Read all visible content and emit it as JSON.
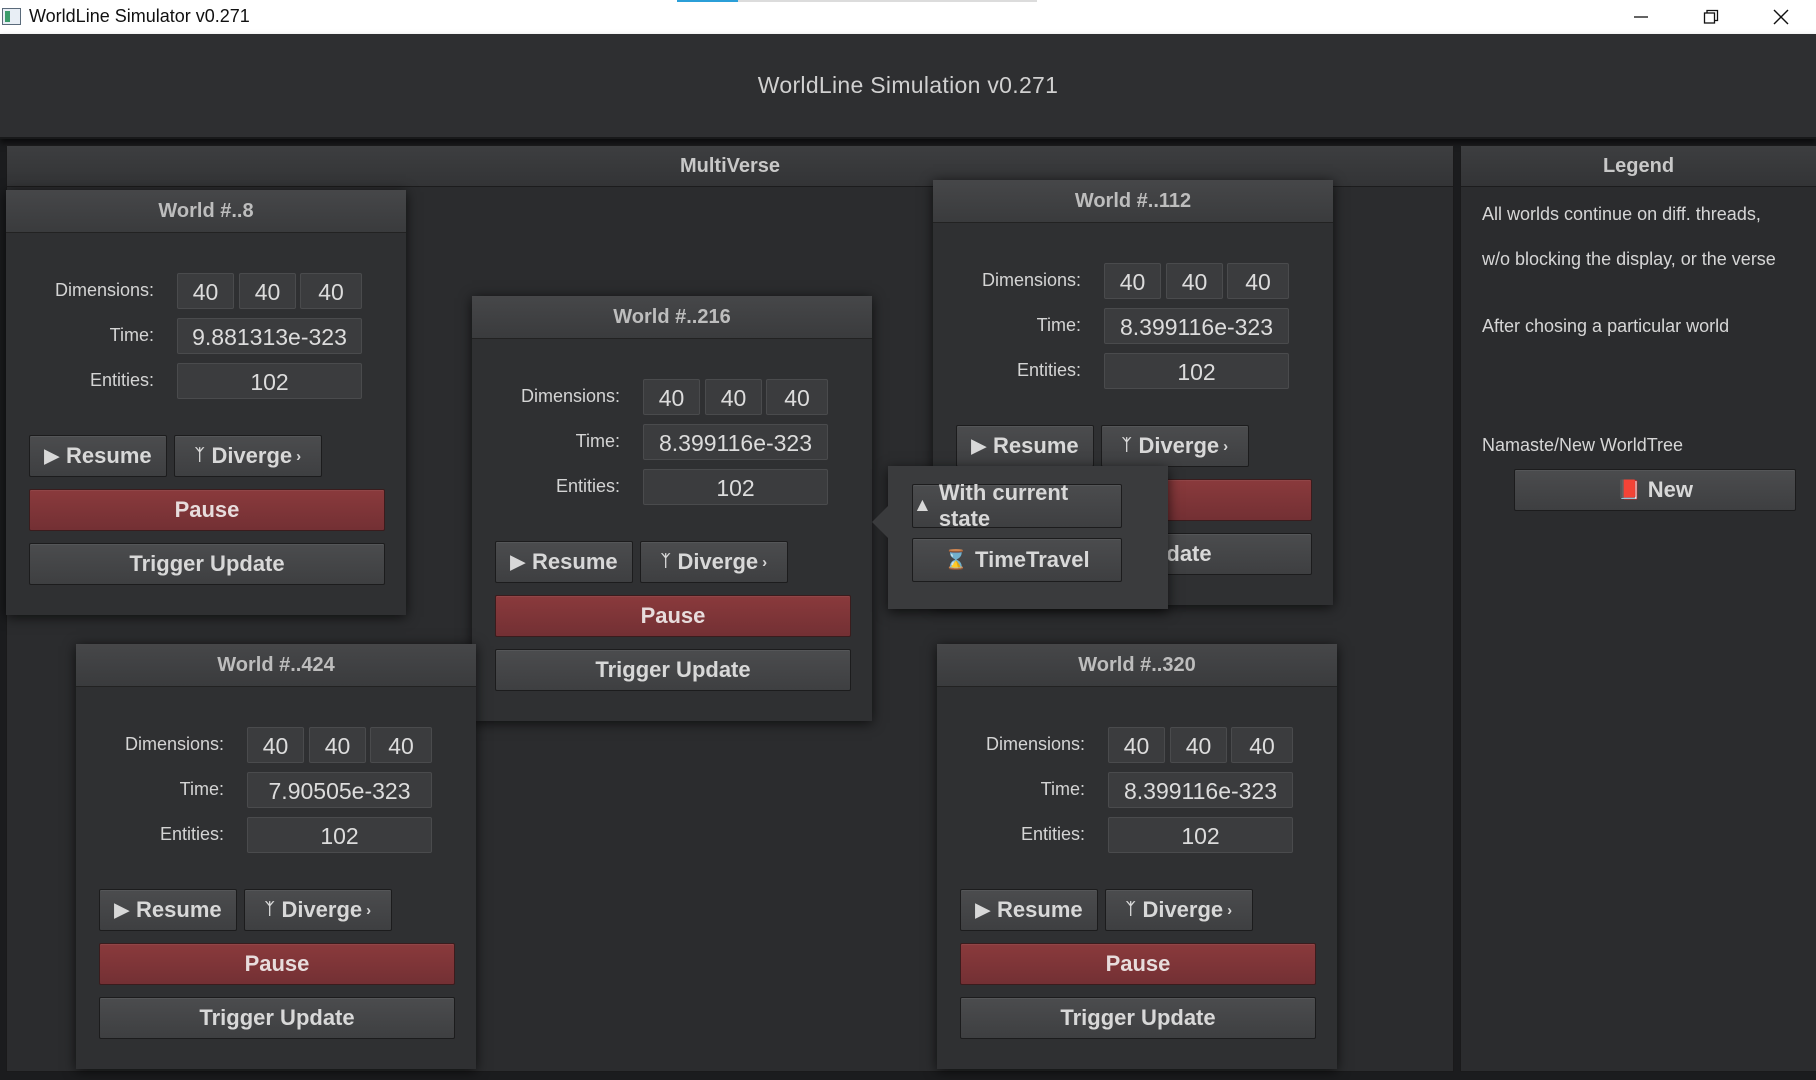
{
  "window": {
    "title": "WorldLine Simulator v0.271",
    "loading_progress": 0.17,
    "controls": [
      "minimize-icon",
      "restore-icon",
      "close-icon"
    ]
  },
  "header": {
    "title": "WorldLine Simulation v0.271"
  },
  "multiverse": {
    "title": "MultiVerse"
  },
  "labels": {
    "dimensions": "Dimensions:",
    "time": "Time:",
    "entities": "Entities:",
    "resume": "Resume",
    "diverge": "Diverge",
    "pause": "Pause",
    "trigger": "Trigger Update"
  },
  "worlds": [
    {
      "title": "World #..8",
      "dims": [
        "40",
        "40",
        "40"
      ],
      "time": "9.881313e-323",
      "entities": "102"
    },
    {
      "title": "World #..216",
      "dims": [
        "40",
        "40",
        "40"
      ],
      "time": "8.399116e-323",
      "entities": "102"
    },
    {
      "title": "World #..112",
      "dims": [
        "40",
        "40",
        "40"
      ],
      "time": "8.399116e-323",
      "entities": "102"
    },
    {
      "title": "World #..424",
      "dims": [
        "40",
        "40",
        "40"
      ],
      "time": "7.90505e-323",
      "entities": "102"
    },
    {
      "title": "World #..320",
      "dims": [
        "40",
        "40",
        "40"
      ],
      "time": "8.399116e-323",
      "entities": "102"
    }
  ],
  "diverge_menu": {
    "items": [
      {
        "label": "With current state",
        "icon": "tree-icon"
      },
      {
        "label": "TimeTravel",
        "icon": "hourglass-icon"
      }
    ]
  },
  "legend": {
    "title": "Legend",
    "lines": [
      "All worlds continue on diff. threads,",
      "w/o blocking the display, or the verse",
      "After chosing a particular world",
      "Namaste/New WorldTree"
    ],
    "new_button": "New",
    "new_icon": "book-icon"
  },
  "colors": {
    "background": "#1b1c1e",
    "panel": "#2b2c2e",
    "pause": "#7c3437",
    "accent": "#2b9fd8"
  }
}
